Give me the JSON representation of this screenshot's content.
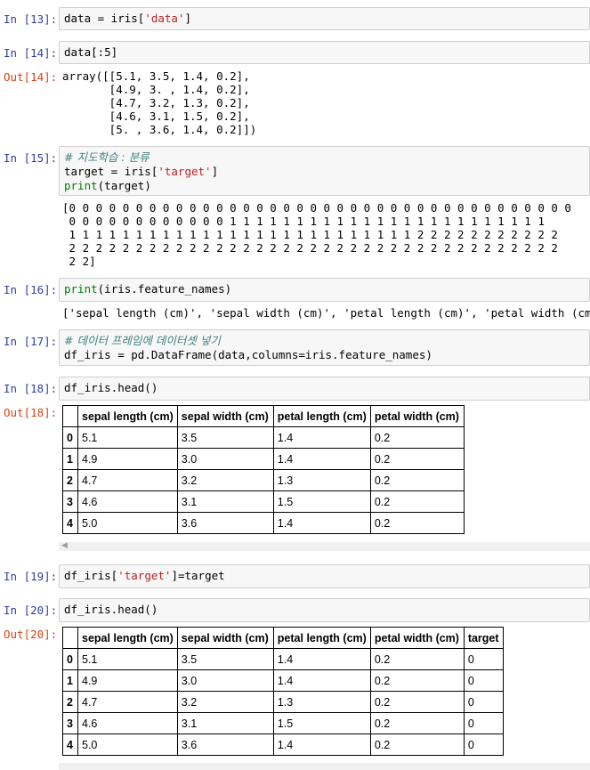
{
  "cells": {
    "c13": {
      "prompt": "In [13]:",
      "code_prefix": "data = iris[",
      "code_str": "'data'",
      "code_suffix": "]"
    },
    "c14": {
      "prompt": "In [14]:",
      "code": "data[:5]",
      "out_prompt": "Out[14]:",
      "output": "array([[5.1, 3.5, 1.4, 0.2],\n       [4.9, 3. , 1.4, 0.2],\n       [4.7, 3.2, 1.3, 0.2],\n       [4.6, 3.1, 1.5, 0.2],\n       [5. , 3.6, 1.4, 0.2]])"
    },
    "c15": {
      "prompt": "In [15]:",
      "comment": "# 지도학습 : 분류",
      "line2_prefix": "target = iris[",
      "line2_str": "'target'",
      "line2_suffix": "]",
      "line3_kw": "print",
      "line3_rest": "(target)",
      "output": "[0 0 0 0 0 0 0 0 0 0 0 0 0 0 0 0 0 0 0 0 0 0 0 0 0 0 0 0 0 0 0 0 0 0 0 0 0 0\n 0 0 0 0 0 0 0 0 0 0 0 0 1 1 1 1 1 1 1 1 1 1 1 1 1 1 1 1 1 1 1 1 1 1 1 1\n 1 1 1 1 1 1 1 1 1 1 1 1 1 1 1 1 1 1 1 1 1 1 1 1 1 1 2 2 2 2 2 2 2 2 2 2 2\n 2 2 2 2 2 2 2 2 2 2 2 2 2 2 2 2 2 2 2 2 2 2 2 2 2 2 2 2 2 2 2 2 2 2 2 2 2\n 2 2]"
    },
    "c16": {
      "prompt": "In [16]:",
      "code_kw": "print",
      "code_rest": "(iris.feature_names)",
      "output": "['sepal length (cm)', 'sepal width (cm)', 'petal length (cm)', 'petal width (cm)']"
    },
    "c17": {
      "prompt": "In [17]:",
      "comment": "# 데이터 프레임에 데이터셋 넣기",
      "line2": "df_iris = pd.DataFrame(data,columns=iris.feature_names)"
    },
    "c18": {
      "prompt": "In [18]:",
      "code": "df_iris.head()",
      "out_prompt": "Out[18]:",
      "table": {
        "columns": [
          "",
          "sepal length (cm)",
          "sepal width (cm)",
          "petal length (cm)",
          "petal width (cm)"
        ],
        "rows": [
          [
            "0",
            "5.1",
            "3.5",
            "1.4",
            "0.2"
          ],
          [
            "1",
            "4.9",
            "3.0",
            "1.4",
            "0.2"
          ],
          [
            "2",
            "4.7",
            "3.2",
            "1.3",
            "0.2"
          ],
          [
            "3",
            "4.6",
            "3.1",
            "1.5",
            "0.2"
          ],
          [
            "4",
            "5.0",
            "3.6",
            "1.4",
            "0.2"
          ]
        ]
      }
    },
    "c19": {
      "prompt": "In [19]:",
      "code_prefix": "df_iris[",
      "code_str": "'target'",
      "code_suffix": "]=target"
    },
    "c20": {
      "prompt": "In [20]:",
      "code": "df_iris.head()",
      "out_prompt": "Out[20]:",
      "table": {
        "columns": [
          "",
          "sepal length (cm)",
          "sepal width (cm)",
          "petal length (cm)",
          "petal width (cm)",
          "target"
        ],
        "rows": [
          [
            "0",
            "5.1",
            "3.5",
            "1.4",
            "0.2",
            "0"
          ],
          [
            "1",
            "4.9",
            "3.0",
            "1.4",
            "0.2",
            "0"
          ],
          [
            "2",
            "4.7",
            "3.2",
            "1.3",
            "0.2",
            "0"
          ],
          [
            "3",
            "4.6",
            "3.1",
            "1.5",
            "0.2",
            "0"
          ],
          [
            "4",
            "5.0",
            "3.6",
            "1.4",
            "0.2",
            "0"
          ]
        ]
      }
    }
  },
  "colors": {
    "in_prompt": "#303F9F",
    "out_prompt": "#D84315",
    "string": "#BA2121",
    "keyword": "#008000",
    "comment": "#408080"
  },
  "icons": {
    "scroll_left": "scroll-left-arrow-icon"
  }
}
